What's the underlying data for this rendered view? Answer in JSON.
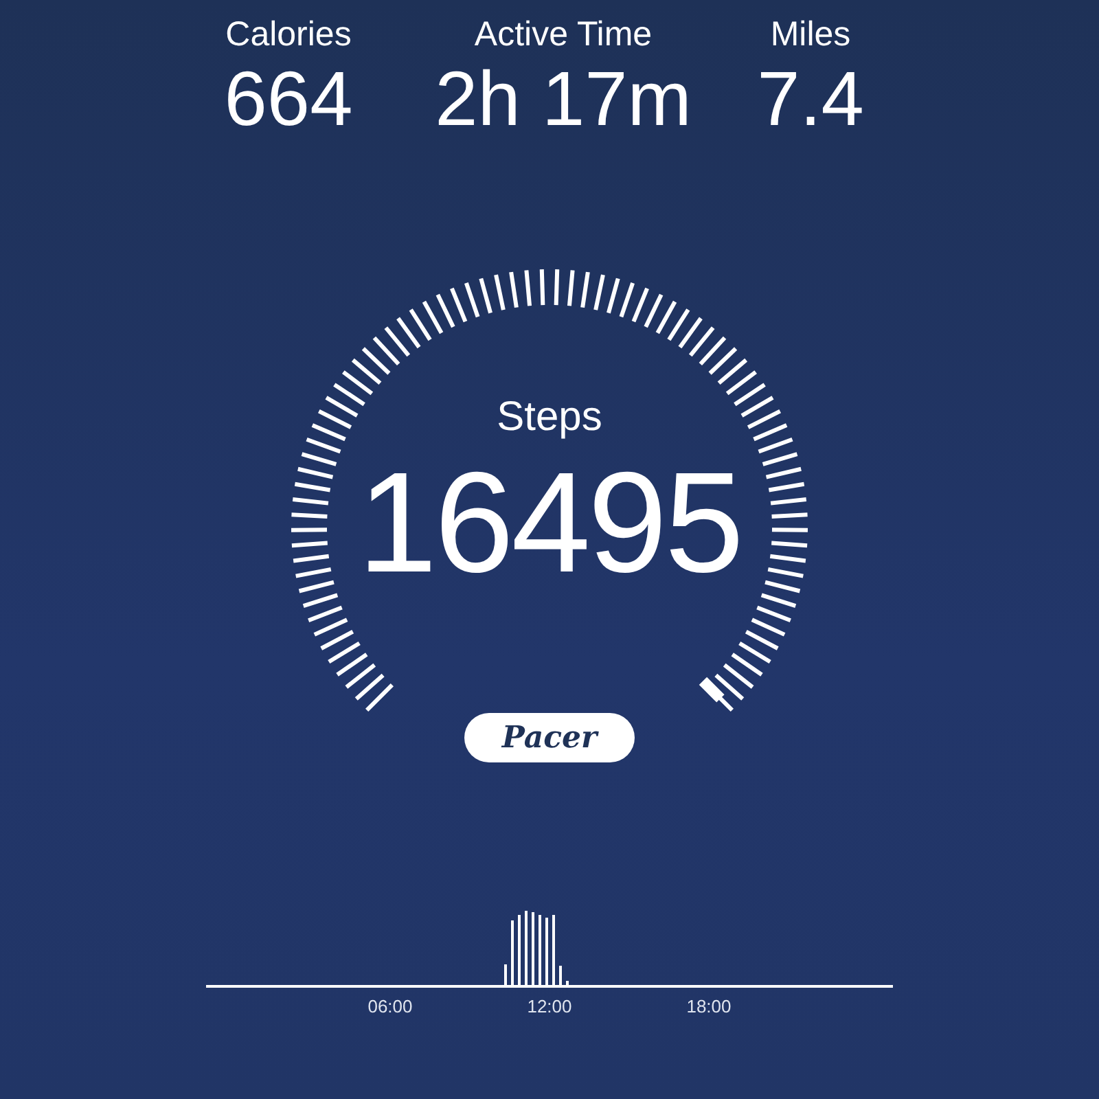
{
  "stats": [
    {
      "label": "Calories",
      "value": "664"
    },
    {
      "label": "Active Time",
      "value": "2h 17m"
    },
    {
      "label": "Miles",
      "value": "7.4"
    }
  ],
  "gauge": {
    "label": "Steps",
    "value": "16495"
  },
  "logo": "Pacer",
  "timeline": {
    "labels": [
      "06:00",
      "12:00",
      "18:00"
    ]
  }
}
